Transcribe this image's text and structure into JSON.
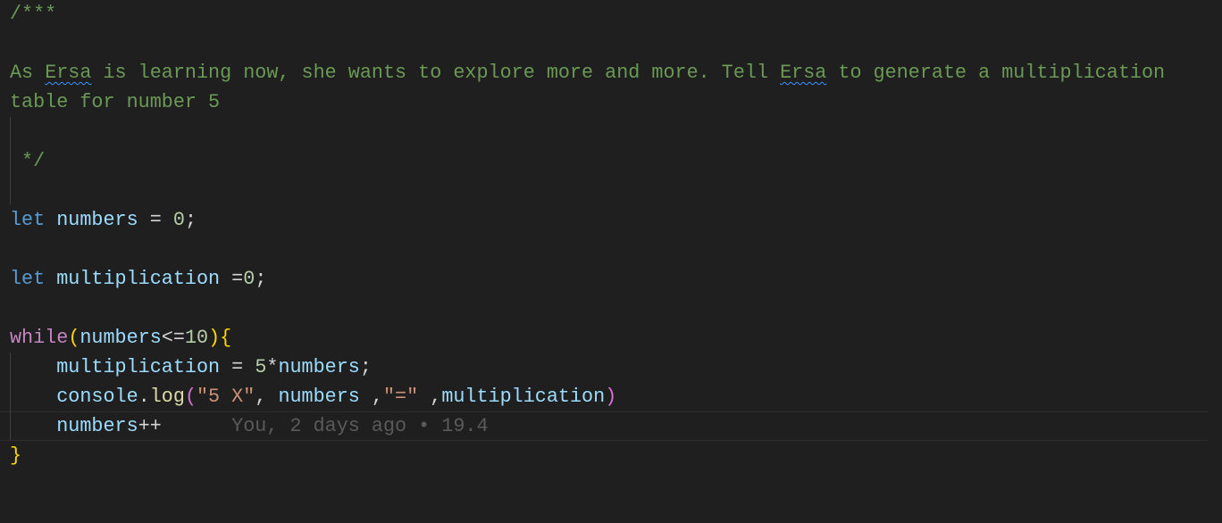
{
  "editor": {
    "lines": [
      {
        "tokens": [
          {
            "t": "/***",
            "c": "cm"
          }
        ]
      },
      {
        "tokens": []
      },
      {
        "tokens": [
          {
            "t": "As ",
            "c": "cm"
          },
          {
            "t": "Ersa",
            "c": "cm squig"
          },
          {
            "t": " is learning now, she wants to explore more and more. Tell ",
            "c": "cm"
          },
          {
            "t": "Ersa",
            "c": "cm squig"
          },
          {
            "t": " to generate a multiplication",
            "c": "cm"
          }
        ]
      },
      {
        "tokens": [
          {
            "t": "table for number 5",
            "c": "cm"
          }
        ]
      },
      {
        "tokens": []
      },
      {
        "tokens": [
          {
            "t": " */",
            "c": "cm"
          }
        ]
      },
      {
        "tokens": []
      },
      {
        "tokens": [
          {
            "t": "let",
            "c": "kw"
          },
          {
            "t": " ",
            "c": "op"
          },
          {
            "t": "numbers",
            "c": "var"
          },
          {
            "t": " = ",
            "c": "op"
          },
          {
            "t": "0",
            "c": "num"
          },
          {
            "t": ";",
            "c": "op"
          }
        ]
      },
      {
        "tokens": []
      },
      {
        "tokens": [
          {
            "t": "let",
            "c": "kw"
          },
          {
            "t": " ",
            "c": "op"
          },
          {
            "t": "multiplication",
            "c": "var"
          },
          {
            "t": " =",
            "c": "op"
          },
          {
            "t": "0",
            "c": "num"
          },
          {
            "t": ";",
            "c": "op"
          }
        ]
      },
      {
        "tokens": []
      },
      {
        "tokens": [
          {
            "t": "while",
            "c": "ctl"
          },
          {
            "t": "(",
            "c": "br1"
          },
          {
            "t": "numbers",
            "c": "var"
          },
          {
            "t": "<=",
            "c": "op"
          },
          {
            "t": "10",
            "c": "num"
          },
          {
            "t": ")",
            "c": "br1"
          },
          {
            "t": "{",
            "c": "br1"
          }
        ]
      },
      {
        "tokens": [
          {
            "t": "    ",
            "c": "op"
          },
          {
            "t": "multiplication",
            "c": "var"
          },
          {
            "t": " = ",
            "c": "op"
          },
          {
            "t": "5",
            "c": "num"
          },
          {
            "t": "*",
            "c": "op"
          },
          {
            "t": "numbers",
            "c": "var"
          },
          {
            "t": ";",
            "c": "op"
          }
        ]
      },
      {
        "tokens": [
          {
            "t": "    ",
            "c": "op"
          },
          {
            "t": "console",
            "c": "var"
          },
          {
            "t": ".",
            "c": "op"
          },
          {
            "t": "log",
            "c": "fn"
          },
          {
            "t": "(",
            "c": "br2"
          },
          {
            "t": "\"5 X\"",
            "c": "str"
          },
          {
            "t": ", ",
            "c": "op"
          },
          {
            "t": "numbers",
            "c": "var"
          },
          {
            "t": " ,",
            "c": "op"
          },
          {
            "t": "\"=\"",
            "c": "str"
          },
          {
            "t": " ,",
            "c": "op"
          },
          {
            "t": "multiplication",
            "c": "var"
          },
          {
            "t": ")",
            "c": "br2"
          }
        ]
      },
      {
        "tokens": [
          {
            "t": "    ",
            "c": "op"
          },
          {
            "t": "numbers",
            "c": "var"
          },
          {
            "t": "++",
            "c": "op"
          },
          {
            "t": "      You, 2 days ago • 19.4",
            "c": "blame"
          }
        ]
      },
      {
        "tokens": [
          {
            "t": "}",
            "c": "br1"
          }
        ]
      }
    ]
  }
}
